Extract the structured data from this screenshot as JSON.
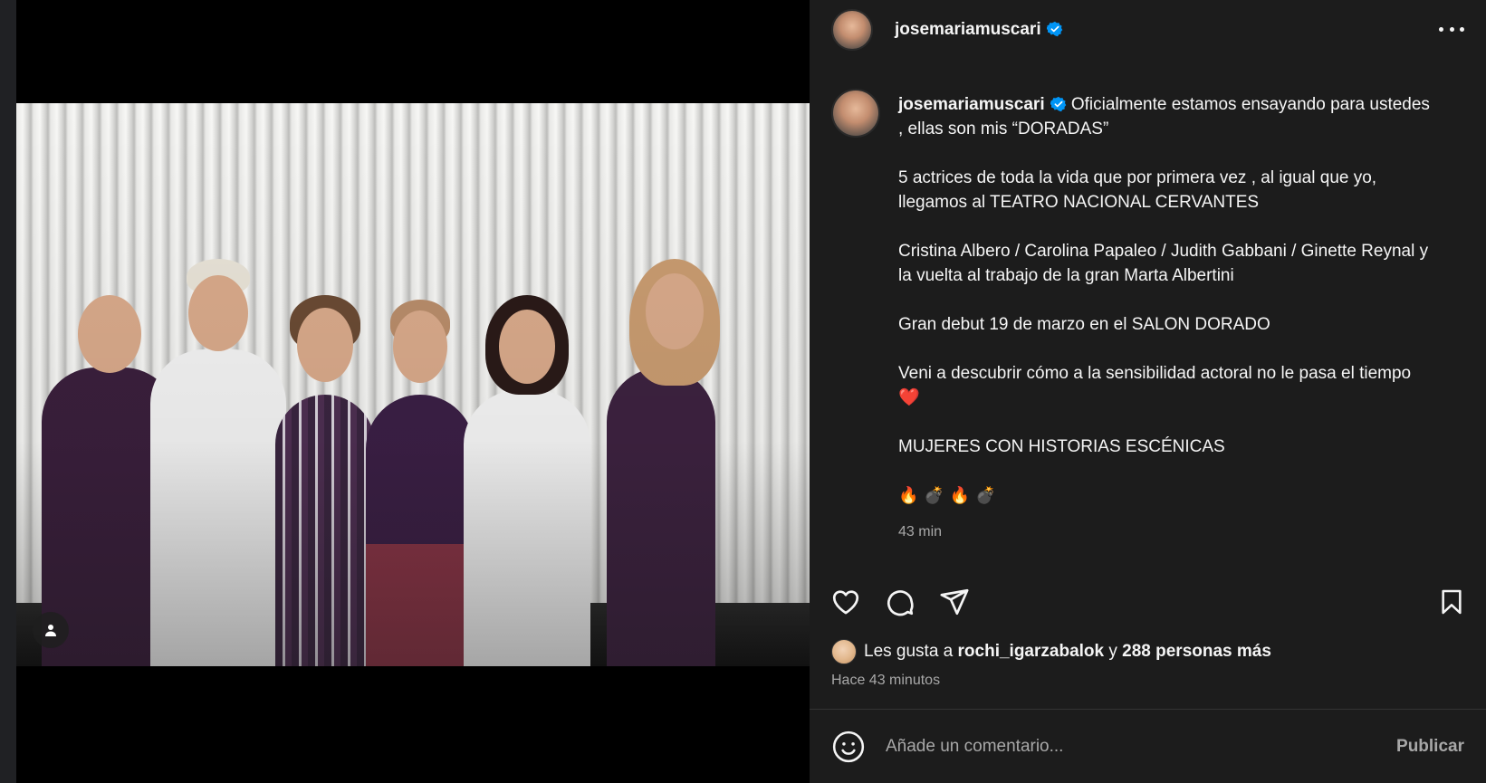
{
  "post": {
    "username": "josemariamuscari",
    "caption": {
      "username": "josemariamuscari",
      "first": "Oficialmente estamos ensayando para ustedes , ellas son mis “DORADAS”",
      "p2": "5 actrices de toda la vida que por primera vez , al igual que yo, llegamos al TEATRO NACIONAL CERVANTES",
      "p3": "Cristina Albero / Carolina Papaleo / Judith Gabbani / Ginette Reynal y la vuelta al trabajo de la gran Marta Albertini",
      "p4": "Gran debut 19 de marzo en el SALON DORADO",
      "p5": "Veni a descubrir cómo a la sensibilidad actoral no le pasa el tiempo ❤️",
      "p6": "MUJERES CON HISTORIAS ESCÉNICAS",
      "emojis": "🔥💣🔥💣",
      "time": "43 min"
    },
    "likes": {
      "prefix": "Les gusta a ",
      "user": "rochi_igarzabalok",
      "joiner": " y ",
      "count": "288 personas más"
    },
    "posted_ago": "Hace 43 minutos",
    "comment": {
      "placeholder": "Añade un comentario...",
      "publish_label": "Publicar"
    }
  },
  "icons": {
    "verified": "verified-badge-icon",
    "more": "more-options-icon",
    "like": "heart-icon",
    "comment": "comment-bubble-icon",
    "share": "paper-plane-icon",
    "save": "bookmark-icon",
    "emoji": "smiley-icon",
    "tag": "person-tag-icon"
  },
  "colors": {
    "background": "#1c1c1c",
    "verified": "#0095f6",
    "secondary_text": "#a8a8a8"
  }
}
